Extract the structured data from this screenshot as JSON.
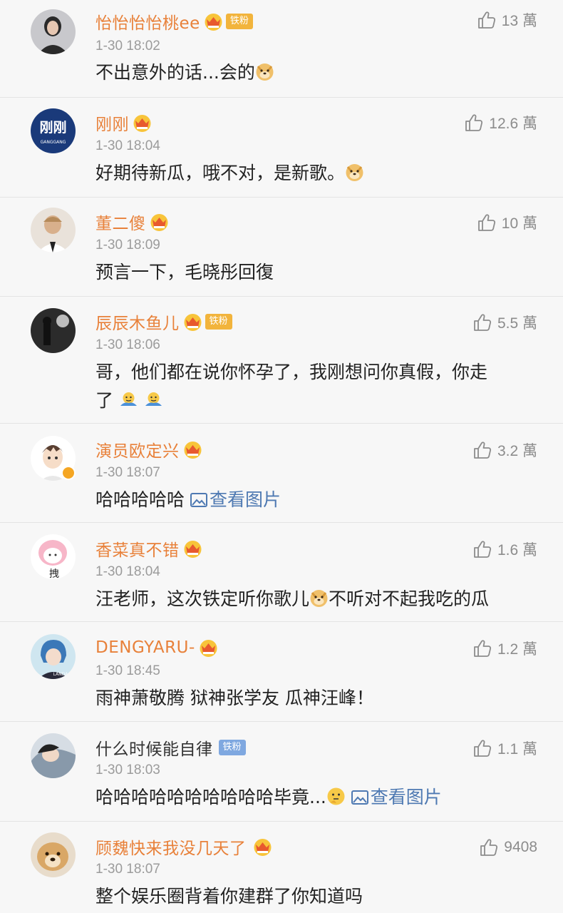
{
  "comments": [
    {
      "username": "怡怡怡怡桃ee",
      "badge": "铁粉",
      "time": "1-30 18:02",
      "likes": "13 萬",
      "text": "不出意外的话...会的",
      "emoji": "doge-emoji"
    },
    {
      "username": "刚刚",
      "avatar_text": "刚刚",
      "avatar_subtext": "GANGGANG",
      "time": "1-30 18:04",
      "likes": "12.6 萬",
      "text": "好期待新瓜，哦不对，是新歌。",
      "emoji": "doge-emoji"
    },
    {
      "username": "董二傻",
      "time": "1-30 18:09",
      "likes": "10 萬",
      "text": "预言一下，毛晓彤回復"
    },
    {
      "username": "辰辰木鱼儿",
      "badge": "铁粉",
      "time": "1-30 18:06",
      "likes": "5.5 萬",
      "text_line1": "哥，他们都在说你怀孕了，我刚想问你真假，你走",
      "text_line2": "了",
      "emoji": "shrug-emoji"
    },
    {
      "username": "演员欧定兴",
      "time": "1-30 18:07",
      "likes": "3.2 萬",
      "text": "哈哈哈哈哈",
      "view_pic": "查看图片"
    },
    {
      "username": "香菜真不错",
      "avatar_text": "拽",
      "time": "1-30 18:04",
      "likes": "1.6 萬",
      "text_before": "汪老师，这次铁定听你歌儿",
      "text_after": "不听对不起我吃的瓜",
      "emoji": "doge-emoji"
    },
    {
      "username": "DENGYARU-",
      "avatar_text": "LANDA",
      "time": "1-30 18:45",
      "likes": "1.2 萬",
      "text": "雨神萧敬腾 狱神张学友 瓜神汪峰！"
    },
    {
      "username": "什么时候能自律",
      "badge": "铁粉",
      "time": "1-30 18:03",
      "likes": "1.1 萬",
      "text": "哈哈哈哈哈哈哈哈哈哈毕竟...",
      "view_pic": "查看图片",
      "emoji": "thinking-emoji"
    },
    {
      "username": "顾魏快来我没几天了",
      "time": "1-30 18:07",
      "likes": "9408",
      "text": "整个娱乐圈背着你建群了你知道吗"
    }
  ],
  "colors": {
    "username": "#e8813a",
    "link": "#4e79b2",
    "meta": "#9b9b9b",
    "text": "#222222",
    "background": "#f7f7f7"
  }
}
